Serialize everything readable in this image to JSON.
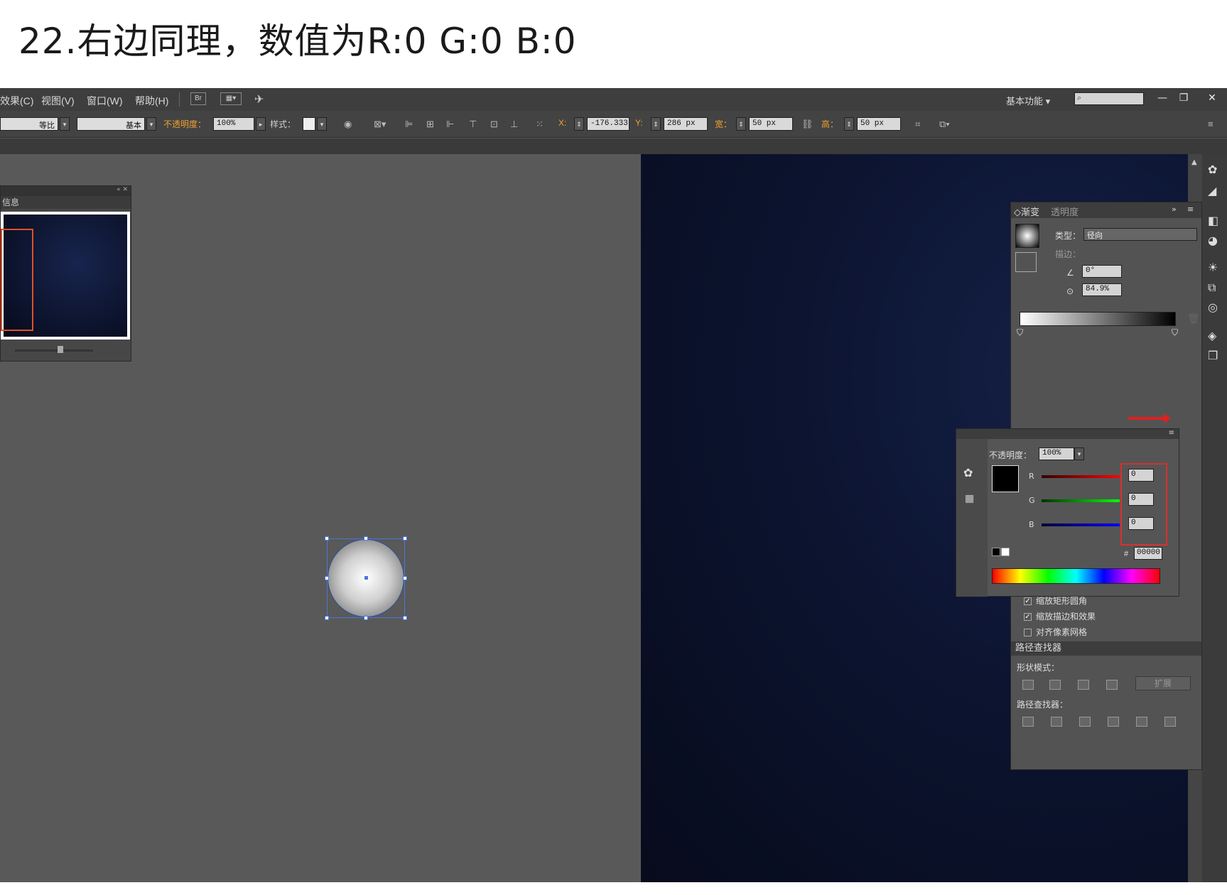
{
  "caption": "22.右边同理，数值为R:0  G:0  B:0",
  "menubar": {
    "items": [
      "效果(C)",
      "视图(V)",
      "窗口(W)",
      "帮助(H)"
    ],
    "br_label": "Br",
    "workspace": "基本功能 ▾",
    "win_min": "—",
    "win_restore": "❐",
    "win_close": "✕"
  },
  "control": {
    "stroke_profile": "等比",
    "brush": "基本",
    "opacity_label": "不透明度：",
    "opacity_value": "100%",
    "style_label": "样式：",
    "x_label": "X:",
    "x_value": "-176.333",
    "y_label": "Y:",
    "y_value": "286 px",
    "w_label": "宽：",
    "w_value": "50 px",
    "h_label": "高：",
    "h_value": "50 px"
  },
  "navigator": {
    "tab": "信息"
  },
  "gradient_panel": {
    "tab_gradient": "◇渐变",
    "tab_transparency": "透明度",
    "type_label": "类型：",
    "type_value": "径向",
    "stroke_label": "描边：",
    "angle_value": "0°",
    "ratio_value": "84.9%",
    "opts": [
      "缩放矩形圆角",
      "缩放描边和效果",
      "对齐像素网格"
    ],
    "opts_checked": [
      true,
      true,
      false
    ]
  },
  "pathfinder": {
    "title": "路径查找器",
    "shape_modes": "形状模式：",
    "pathfinders": "路径查找器：",
    "expand": "扩展"
  },
  "color_panel": {
    "opacity_label": "不透明度：",
    "opacity_value": "100%",
    "r_label": "R",
    "g_label": "G",
    "b_label": "B",
    "r_value": "0",
    "g_value": "0",
    "b_value": "0",
    "hex_label": "#",
    "hex_value": "00000"
  },
  "colors": {
    "accent_orange": "#f0a030",
    "highlight_red": "#d83030",
    "selection_blue": "#4a78d8"
  }
}
